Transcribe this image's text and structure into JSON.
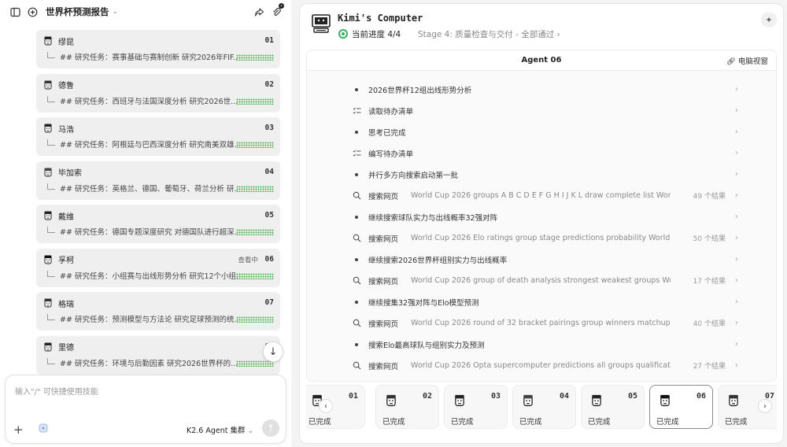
{
  "header": {
    "title": "世界杯预测报告"
  },
  "agents": [
    {
      "name": "缪昆",
      "num": "01",
      "status": "",
      "task": "## 研究任务：赛事基础与赛制创新 研究2026年FIF..."
    },
    {
      "name": "德鲁",
      "num": "02",
      "status": "",
      "task": "## 研究任务：西班牙与法国深度分析 研究2026世..."
    },
    {
      "name": "马浩",
      "num": "03",
      "status": "",
      "task": "## 研究任务：阿根廷与巴西深度分析 研究南美双雄..."
    },
    {
      "name": "毕加索",
      "num": "04",
      "status": "",
      "task": "## 研究任务：英格兰、德国、葡萄牙、荷兰分析 研..."
    },
    {
      "name": "戴维",
      "num": "05",
      "status": "",
      "task": "## 研究任务：德国专题深度研究 对德国队进行超深..."
    },
    {
      "name": "孚柯",
      "num": "06",
      "status": "查看中",
      "task": "## 研究任务：小组赛与出线形势分析 研究12个小组..."
    },
    {
      "name": "格瑞",
      "num": "07",
      "status": "",
      "task": "## 研究任务：预测模型与方法论 研究足球预测的统..."
    },
    {
      "name": "里德",
      "num": "08",
      "status": "",
      "task": "## 研究任务：环境与后勤因素 研究2026世界杯的..."
    }
  ],
  "composer": {
    "placeholder": "输入\"/\" 可快捷使用技能",
    "model": "K2.6 Agent 集群"
  },
  "computer": {
    "title": "Kimi's Computer",
    "progress": "当前进度 4/4",
    "stage": "Stage 4: 质量检查与交付 - 全部通过"
  },
  "viewer": {
    "agent_title": "Agent 06",
    "view_link": "电脑视窗"
  },
  "log": [
    {
      "type": "bullet",
      "icon": "bullet",
      "label": "2026世界杯12组出线形势分析",
      "query": "",
      "count": ""
    },
    {
      "type": "todo",
      "icon": "checklist-icon",
      "label": "读取待办清单",
      "query": "",
      "count": ""
    },
    {
      "type": "bullet",
      "icon": "bullet",
      "label": "思考已完成",
      "query": "",
      "count": ""
    },
    {
      "type": "todo",
      "icon": "checklist-icon",
      "label": "编写待办清单",
      "query": "",
      "count": ""
    },
    {
      "type": "bullet",
      "icon": "bullet",
      "label": "并行多方向搜索启动第一批",
      "query": "",
      "count": ""
    },
    {
      "type": "search",
      "icon": "search-icon",
      "label": "搜索网页",
      "query": "World Cup 2026 groups A B C D E F G H I J K L draw complete list World Cup ...",
      "count": "49 个结果"
    },
    {
      "type": "bullet",
      "icon": "bullet",
      "label": "继续搜索球队实力与出线概率32强对阵",
      "query": "",
      "count": ""
    },
    {
      "type": "search",
      "icon": "search-icon",
      "label": "搜索网页",
      "query": "World Cup 2026 Elo ratings group stage predictions probability World Cup 20...",
      "count": "50 个结果"
    },
    {
      "type": "bullet",
      "icon": "bullet",
      "label": "继续搜索2026世界杯组别实力与出线概率",
      "query": "",
      "count": ""
    },
    {
      "type": "search",
      "icon": "search-icon",
      "label": "搜索网页",
      "query": "World Cup 2026 group of death analysis strongest weakest groups World Cup ...",
      "count": "17 个结果"
    },
    {
      "type": "bullet",
      "icon": "bullet",
      "label": "继续搜集32强对阵与Elo模型预测",
      "query": "",
      "count": ""
    },
    {
      "type": "search",
      "icon": "search-icon",
      "label": "搜索网页",
      "query": "World Cup 2026 round of 32 bracket pairings group winners matchups World ...",
      "count": "40 个结果"
    },
    {
      "type": "bullet",
      "icon": "bullet",
      "label": "搜索Elo最高球队与组别实力及预测",
      "query": "",
      "count": ""
    },
    {
      "type": "search",
      "icon": "search-icon",
      "label": "搜索网页",
      "query": "World Cup 2026 Opta supercomputer predictions all groups qualification prob...",
      "count": "27 个结果"
    }
  ],
  "tiles": [
    {
      "num": "01",
      "status": "已完成",
      "active": false
    },
    {
      "num": "02",
      "status": "已完成",
      "active": false
    },
    {
      "num": "03",
      "status": "已完成",
      "active": false
    },
    {
      "num": "04",
      "status": "已完成",
      "active": false
    },
    {
      "num": "05",
      "status": "已完成",
      "active": false
    },
    {
      "num": "06",
      "status": "已完成",
      "active": true
    },
    {
      "num": "07",
      "status": "已完成",
      "active": false
    }
  ],
  "colors": {
    "progress_green": "#3cae5e",
    "dots_green": "#5ab35a"
  }
}
